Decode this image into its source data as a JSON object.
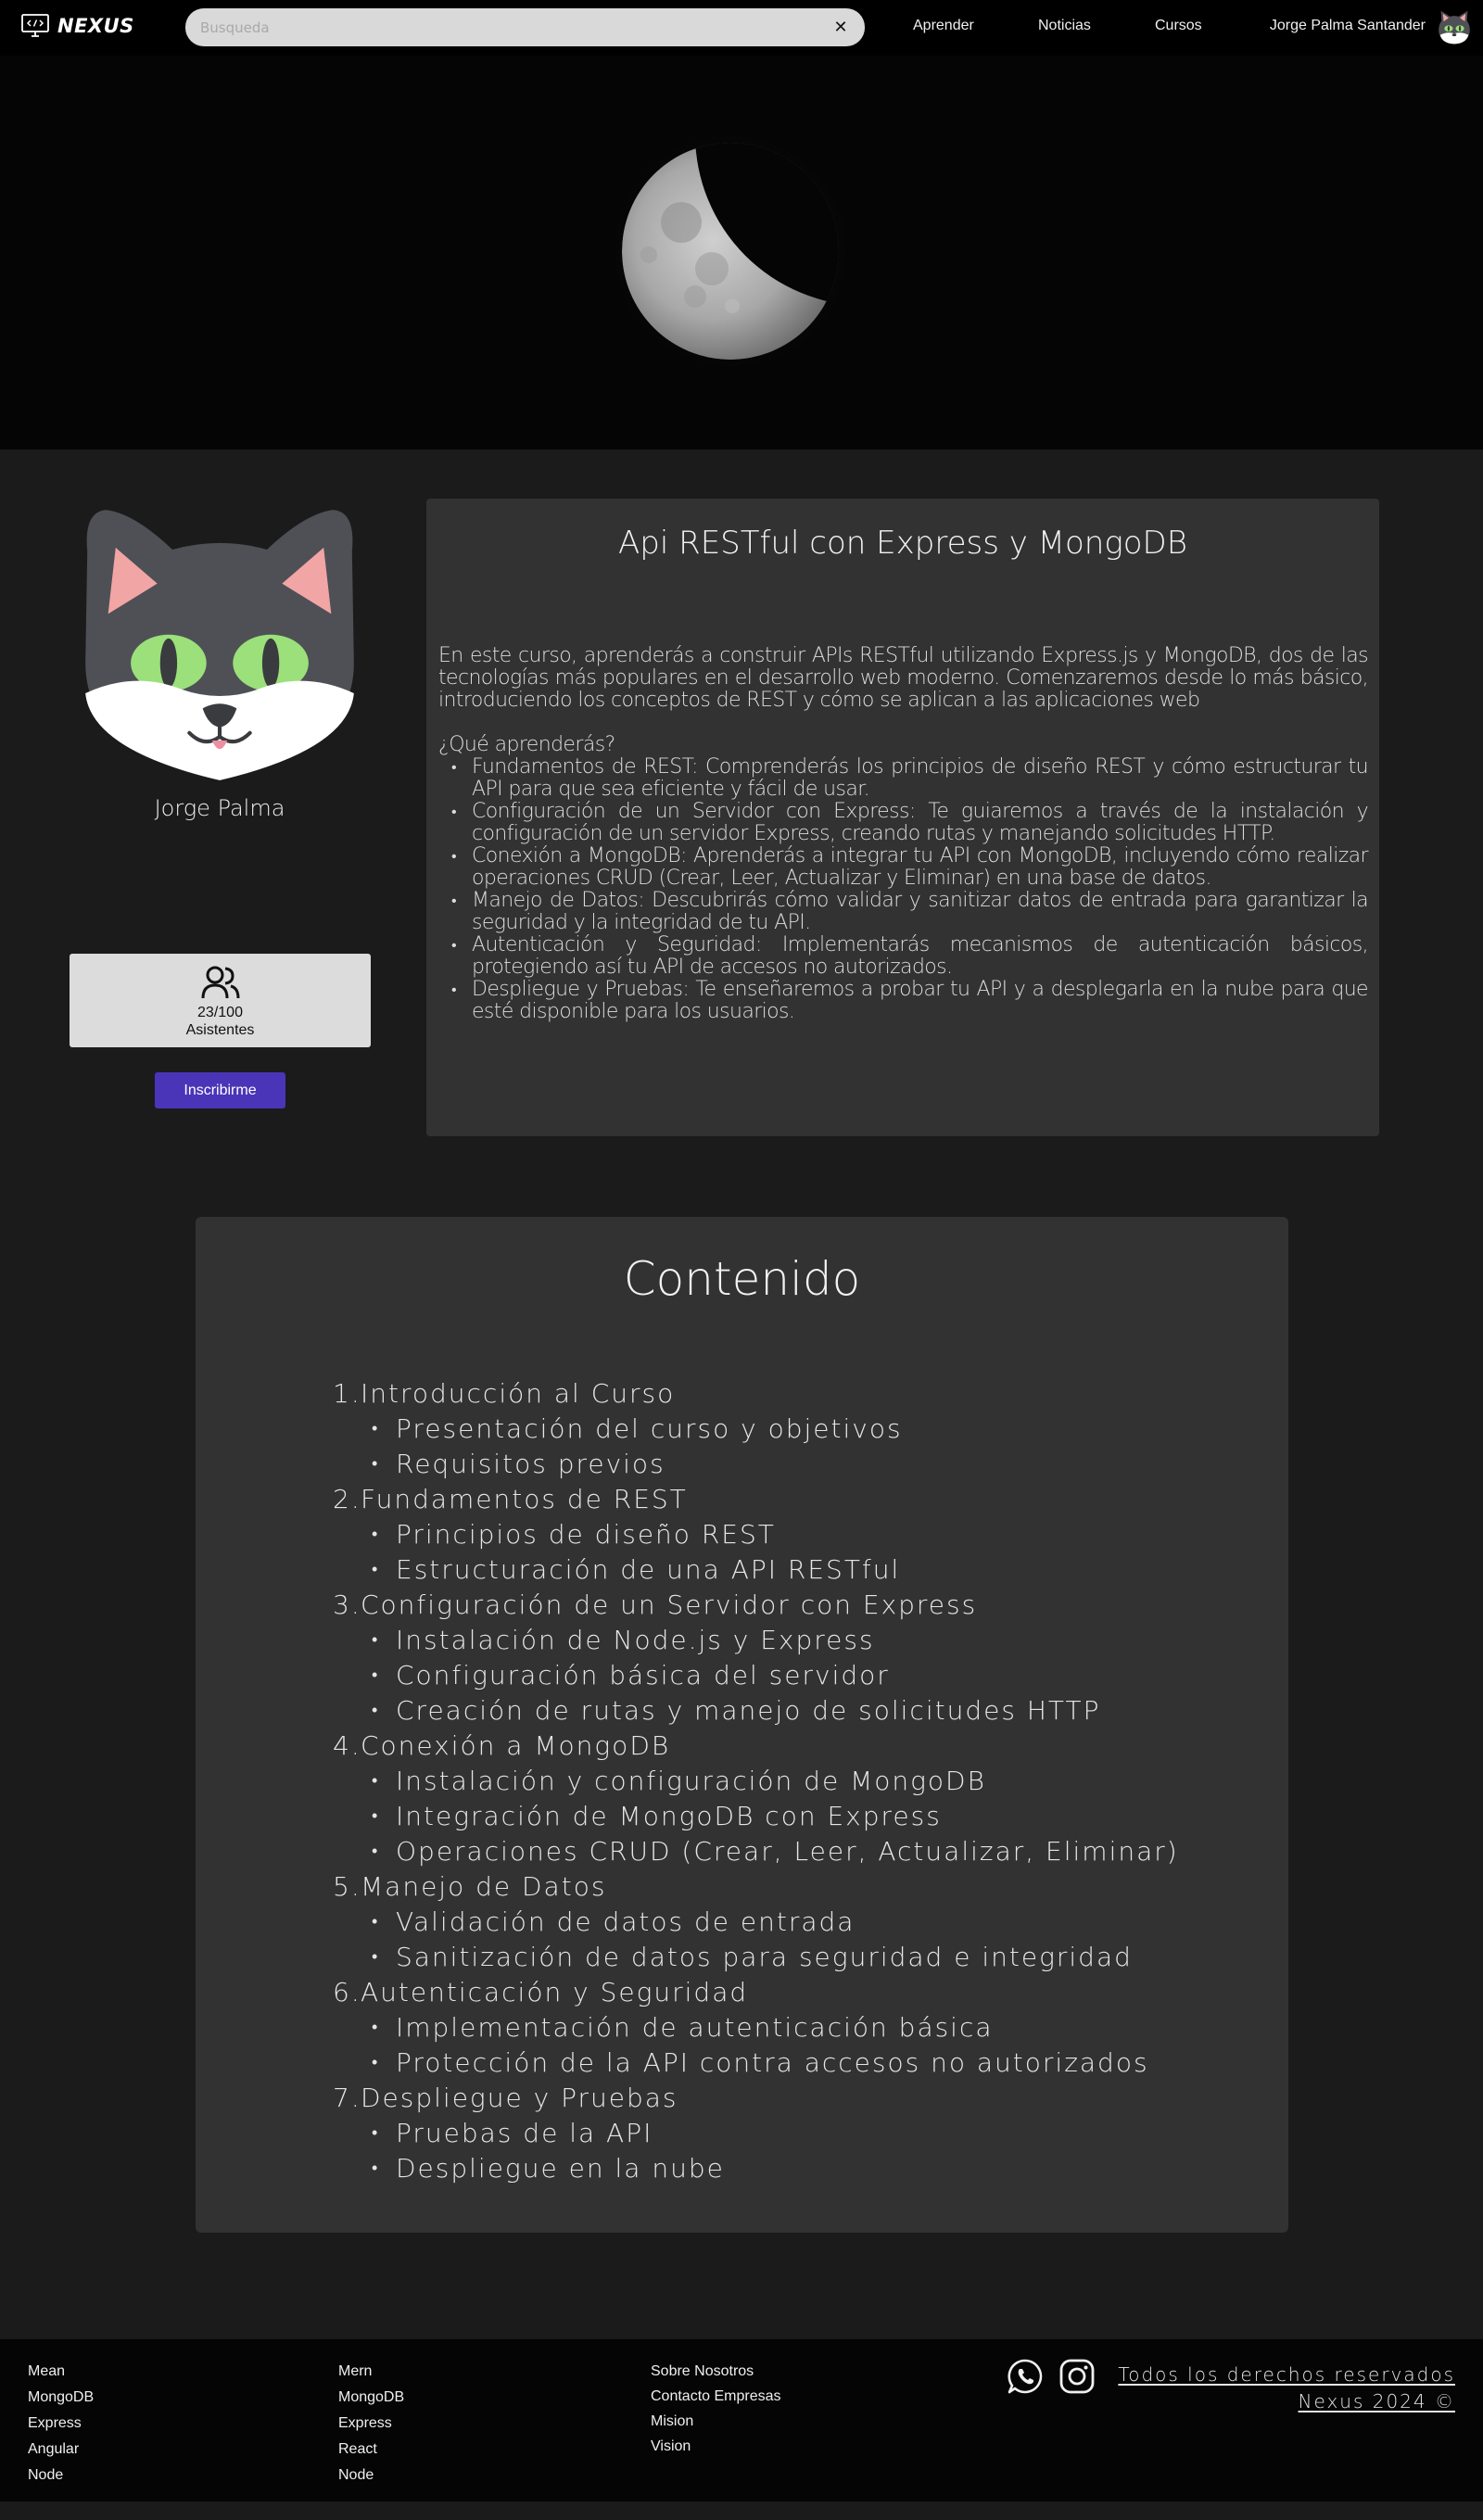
{
  "navbar": {
    "brand": "NEXUS",
    "search_placeholder": "Busqueda",
    "clear_glyph": "✕",
    "links": [
      "Aprender",
      "Noticias",
      "Cursos"
    ],
    "user_name": "Jorge Palma Santander"
  },
  "hero": {
    "image": "moon",
    "background": "#050505"
  },
  "profile": {
    "name": "Jorge Palma",
    "attendees_count": "23/100",
    "attendees_label": "Asistentes",
    "subscribe_label": "Inscribirme"
  },
  "course": {
    "title": "Api RESTful con Express y MongoDB",
    "intro": "En este curso, aprenderás a construir APIs RESTful utilizando Express.js y MongoDB, dos de las tecnologías más populares en el desarrollo web moderno. Comenzaremos desde lo más básico, introduciendo los conceptos de REST y cómo se aplican a las aplicaciones web",
    "question": "¿Qué aprenderás?",
    "learn_items": [
      "Fundamentos de REST: Comprenderás los principios de diseño REST y cómo estructurar tu API para que sea eficiente y fácil de usar.",
      "Configuración de un Servidor con Express: Te guiaremos a través de la instalación y configuración de un servidor Express, creando rutas y manejando solicitudes HTTP.",
      "Conexión a MongoDB: Aprenderás a integrar tu API con MongoDB, incluyendo cómo realizar operaciones CRUD (Crear, Leer, Actualizar y Eliminar) en una base de datos.",
      "Manejo de Datos: Descubrirás cómo validar y sanitizar datos de entrada para garantizar la seguridad y la integridad de tu API.",
      "Autenticación y Seguridad: Implementarás mecanismos de autenticación básicos, protegiendo así tu API de accesos no autorizados.",
      "Despliegue y Pruebas: Te enseñaremos a probar tu API y a desplegarla en la nube para que esté disponible para los usuarios."
    ]
  },
  "content": {
    "title": "Contenido",
    "modules": [
      {
        "num": "1.",
        "title": "Introducción al Curso",
        "items": [
          "Presentación del curso y objetivos",
          "Requisitos previos"
        ]
      },
      {
        "num": "2.",
        "title": "Fundamentos de REST",
        "items": [
          "Principios de diseño REST",
          "Estructuración de una API RESTful"
        ]
      },
      {
        "num": "3.",
        "title": "Configuración de un Servidor con Express",
        "items": [
          "Instalación de Node.js y Express",
          "Configuración básica del servidor",
          "Creación de rutas y manejo de solicitudes HTTP"
        ]
      },
      {
        "num": "4.",
        "title": "Conexión a MongoDB",
        "items": [
          "Instalación y configuración de MongoDB",
          "Integración de MongoDB con Express",
          "Operaciones CRUD (Crear, Leer, Actualizar, Eliminar)"
        ]
      },
      {
        "num": "5.",
        "title": "Manejo de Datos",
        "items": [
          "Validación de datos de entrada",
          "Sanitización de datos para seguridad e integridad"
        ]
      },
      {
        "num": "6.",
        "title": "Autenticación y Seguridad",
        "items": [
          "Implementación de autenticación básica",
          "Protección de la API contra accesos no autorizados"
        ]
      },
      {
        "num": "7.",
        "title": "Despliegue y Pruebas",
        "items": [
          "Pruebas de la API",
          "Despliegue en la nube"
        ]
      }
    ]
  },
  "footer": {
    "col1": [
      "Mean",
      "MongoDB",
      "Express",
      "Angular",
      "Node"
    ],
    "col2": [
      "Mern",
      "MongoDB",
      "Express",
      "React",
      "Node"
    ],
    "col3": [
      "Sobre Nosotros",
      "Contacto Empresas",
      "Mision",
      "Vision"
    ],
    "social_icons": [
      "whatsapp-icon",
      "instagram-icon"
    ],
    "rights_line1": "Todos los derechos reservados",
    "rights_line2": "Nexus 2024 ©"
  },
  "colors": {
    "page_bg": "#1b1b1b",
    "card_bg": "#323232",
    "navbar_bg": "#000000",
    "accent_button": "#4a35b9",
    "search_bg": "#d9d9d9",
    "attendees_bg": "#dcdcdc"
  }
}
